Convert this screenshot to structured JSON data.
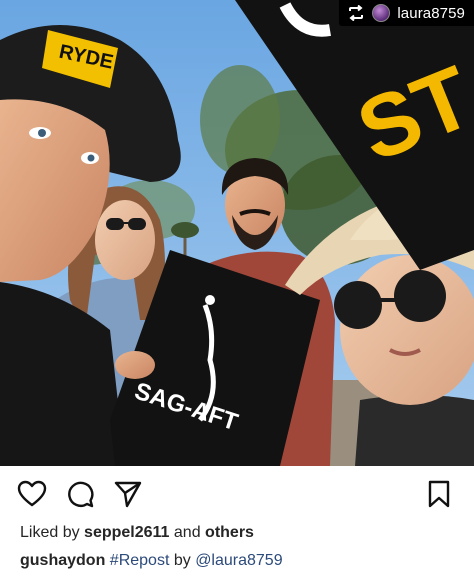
{
  "repost_badge": {
    "username": "laura8759",
    "icon": "repost-icon"
  },
  "photo": {
    "description_icon": "photo",
    "cap_text": "RYDE",
    "sign_text": "SAG-AFT",
    "sign_partial": "ST",
    "colors": {
      "sky": "#7fb4e6",
      "sign_black": "#111111",
      "sign_yellow": "#f5b800"
    }
  },
  "actions": {
    "like_icon": "heart-icon",
    "comment_icon": "comment-icon",
    "share_icon": "share-icon",
    "save_icon": "bookmark-icon"
  },
  "likes": {
    "prefix": "Liked by ",
    "user": "seppel2611",
    "middle": " and ",
    "others": "others"
  },
  "caption": {
    "username": "gushaydon",
    "hashtag": "#Repost",
    "by": " by ",
    "mention": "@laura8759"
  }
}
